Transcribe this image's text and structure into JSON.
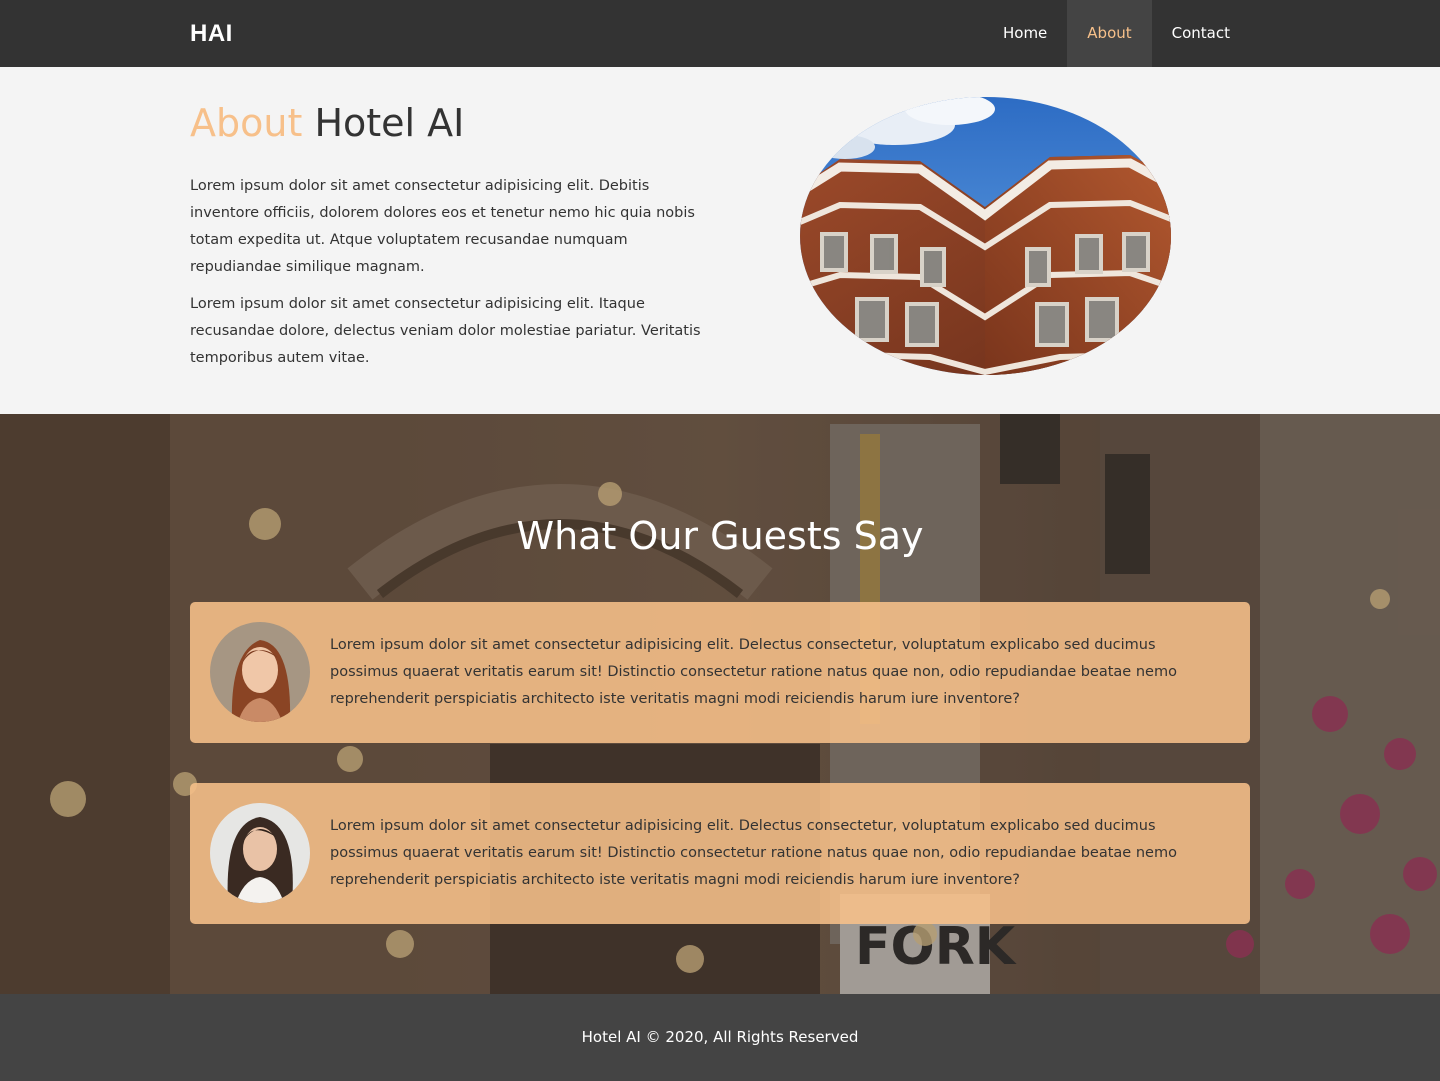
{
  "nav": {
    "logo": "HAI",
    "links": [
      "Home",
      "About",
      "Contact"
    ],
    "active": "About"
  },
  "about": {
    "title_accent": "About",
    "title_rest": " Hotel AI",
    "paragraphs": [
      "Lorem ipsum dolor sit amet consectetur adipisicing elit. Debitis inventore officiis, dolorem dolores eos et tenetur nemo hic quia nobis totam expedita ut. Atque voluptatem recusandae numquam repudiandae similique magnam.",
      "Lorem ipsum dolor sit amet consectetur adipisicing elit. Itaque recusandae dolore, delectus veniam dolor molestiae pariatur. Veritatis temporibus autem vitae."
    ]
  },
  "testimonials": {
    "title": "What Our Guests Say",
    "items": [
      {
        "text": "Lorem ipsum dolor sit amet consectetur adipisicing elit. Delectus consectetur, voluptatum explicabo sed ducimus possimus quaerat veritatis earum sit! Distinctio consectetur ratione natus quae non, odio repudiandae beatae nemo reprehenderit perspiciatis architecto iste veritatis magni modi reiciendis harum iure inventore?"
      },
      {
        "text": "Lorem ipsum dolor sit amet consectetur adipisicing elit. Delectus consectetur, voluptatum explicabo sed ducimus possimus quaerat veritatis earum sit! Distinctio consectetur ratione natus quae non, odio repudiandae beatae nemo reprehenderit perspiciatis architecto iste veritatis magni modi reiciendis harum iure inventore?"
      }
    ],
    "sign_text": "FORK"
  },
  "footer": {
    "text": "Hotel AI © 2020, All Rights Reserved"
  },
  "colors": {
    "accent": "#f7c08a",
    "navbar": "#333333",
    "footer": "#444444",
    "card": "#f7c08a"
  }
}
